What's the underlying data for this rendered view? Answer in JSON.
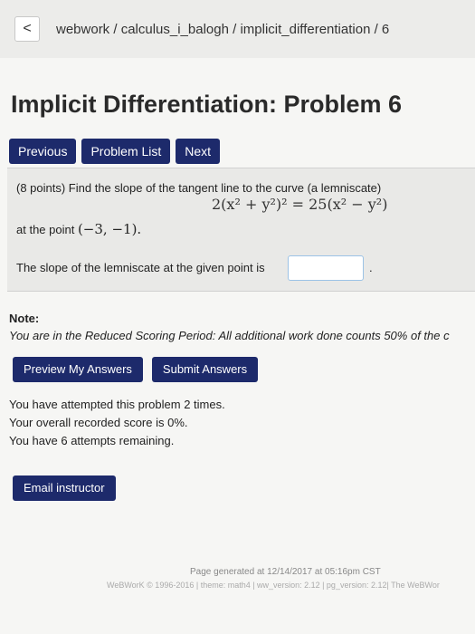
{
  "breadcrumb": {
    "back_icon": "chevron-left-icon",
    "back_glyph": "<",
    "path": "webwork / calculus_i_balogh / implicit_differentiation / 6"
  },
  "page_title": "Implicit Differentiation: Problem 6",
  "nav": {
    "previous": "Previous",
    "problem_list": "Problem List",
    "next": "Next"
  },
  "problem": {
    "statement": "(8 points) Find the slope of the tangent line to the curve (a lemniscate)",
    "equation": "2(x² + y²)² = 25(x² − y²)",
    "point_prefix": "at the point ",
    "point": "(−3, −1).",
    "slope_prompt": "The slope of the lemniscate at the given point is",
    "answer_value": "",
    "answer_suffix": "."
  },
  "note": {
    "label": "Note:",
    "text": "You are in the Reduced Scoring Period: All additional work done counts 50% of the c"
  },
  "actions": {
    "preview": "Preview My Answers",
    "submit": "Submit Answers"
  },
  "attempts": {
    "line1": "You have attempted this problem 2 times.",
    "line2": "Your overall recorded score is 0%.",
    "line3": "You have 6 attempts remaining."
  },
  "email_button": "Email instructor",
  "footer": {
    "generated": "Page generated at 12/14/2017 at 05:16pm CST",
    "version": "WeBWorK © 1996-2016 | theme: math4 | ww_version: 2.12 | pg_version: 2.12| The WeBWor"
  },
  "colors": {
    "button_bg": "#1d2a6b",
    "page_bg": "#f6f6f4",
    "problem_bg": "#e9e9e7"
  }
}
